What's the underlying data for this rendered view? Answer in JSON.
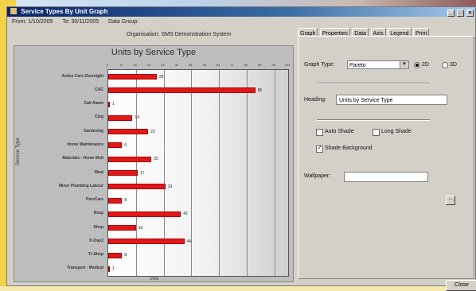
{
  "window": {
    "title": "Service Types By Unit Graph",
    "controls": [
      "_",
      "□",
      "×"
    ]
  },
  "info": {
    "from": "From: 1/10/2005",
    "to": "To: 30/11/2005",
    "data_group": "Data Group:",
    "organisation": "Organisation: SMS Demonstration System"
  },
  "tabs": [
    "Graph",
    "Properties",
    "Data",
    "Axis",
    "Legend",
    "Print"
  ],
  "graph_settings": {
    "graph_type_label": "Graph Type:",
    "graph_type_value": "Pareto",
    "radio_2d": "2D",
    "radio_3d": "3D",
    "heading_label": "Heading:",
    "heading_value": "Units by Service Type",
    "auto_shade": "Auto Shade",
    "long_shade": "Long Shade",
    "shade_background": "Shade Background",
    "wallpaper_label": "Wallpaper:",
    "wallpaper_value": "",
    "browse_label": "..."
  },
  "close_label": "Close",
  "chart_data": {
    "type": "bar",
    "title": "Units by Service Type",
    "ylabel": "Service Type",
    "xlabel": "Units",
    "xlim": [
      0,
      104
    ],
    "x_ticks": [
      0,
      8,
      16,
      24,
      32,
      40,
      48,
      56,
      64,
      72,
      80,
      88,
      96,
      104
    ],
    "categories": [
      "Active Care Overnight",
      "CAC",
      "Call Alarm",
      "Cleg",
      "Gardening",
      "Home Maintenance",
      "Materials - Home Mntl",
      "Meal",
      "Minor Plumbing Labour",
      "PersCare",
      "Resp",
      "Shop",
      "Tr-Day2",
      "Tr-Shop",
      "Transport - Medical"
    ],
    "values": [
      28,
      85,
      1,
      14,
      23,
      8,
      25,
      17,
      33,
      8,
      42,
      16,
      44,
      8,
      1
    ],
    "value_labels": [
      "28",
      "85",
      "1",
      "14",
      "23",
      "6",
      "25",
      "17",
      "33",
      "8",
      "42",
      "16",
      "44",
      "8",
      "1"
    ],
    "bar_color": "#e01818",
    "grid": true
  }
}
